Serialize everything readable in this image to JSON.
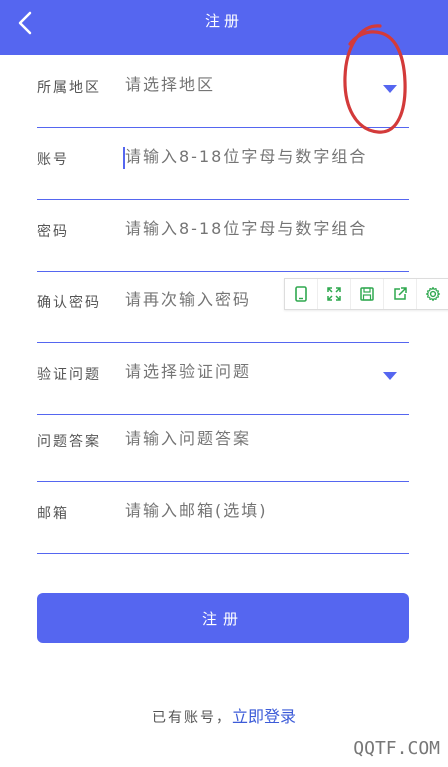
{
  "header": {
    "title": "注册",
    "back_icon": "chevron-left-icon"
  },
  "form": {
    "fields": [
      {
        "label": "所属地区",
        "placeholder": "请选择地区",
        "has_dropdown": true
      },
      {
        "label": "账号",
        "placeholder": "请输入8-18位字母与数字组合",
        "has_dropdown": false
      },
      {
        "label": "密码",
        "placeholder": "请输入8-18位字母与数字组合",
        "has_dropdown": false
      },
      {
        "label": "确认密码",
        "placeholder": "请再次输入密码",
        "has_dropdown": false
      },
      {
        "label": "验证问题",
        "placeholder": "请选择验证问题",
        "has_dropdown": true
      },
      {
        "label": "问题答案",
        "placeholder": "请输入问题答案",
        "has_dropdown": false
      },
      {
        "label": "邮箱",
        "placeholder": "请输入邮箱(选填)",
        "has_dropdown": false
      }
    ],
    "submit_label": "注册"
  },
  "footer": {
    "prompt": "已有账号，",
    "login_link": "立即登录"
  },
  "floating_toolbar": {
    "icons": [
      "tablet-icon",
      "expand-icon",
      "save-icon",
      "share-icon",
      "gear-icon"
    ],
    "color": "#2fa84f"
  },
  "watermark": "QQTF.COM",
  "colors": {
    "accent": "#5566f0",
    "annotation": "#d33a3a"
  }
}
